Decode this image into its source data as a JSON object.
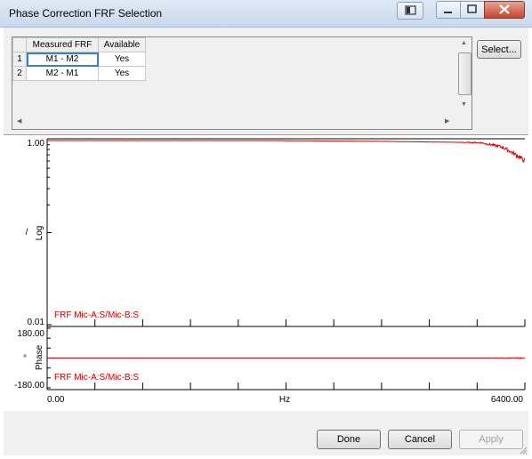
{
  "window": {
    "title": "Phase Correction FRF Selection"
  },
  "table": {
    "columns": [
      "Measured FRF",
      "Available"
    ],
    "rows": [
      {
        "index": "1",
        "frf": "M1 - M2",
        "available": "Yes"
      },
      {
        "index": "2",
        "frf": "M2 - M1",
        "available": "Yes"
      }
    ]
  },
  "buttons": {
    "select": "Select...",
    "done": "Done",
    "cancel": "Cancel",
    "apply": "Apply"
  },
  "graph": {
    "top": {
      "y_max_label": "1.00",
      "y_min_label": "0.01",
      "axis_unit": "/",
      "axis_label": "Log",
      "trace_label": "FRF Mic-A:S/Mic-B:S"
    },
    "bottom": {
      "y_max_label": "180.00",
      "y_min_label": "-180.00",
      "axis_unit": "°",
      "axis_label": "Phase",
      "trace_label": "FRF Mic-A:S/Mic-B:S"
    },
    "x_min_label": "0.00",
    "x_unit_label": "Hz",
    "x_max_label": "6400.00",
    "trace_color": "#cc0000"
  },
  "chart_data": [
    {
      "type": "line",
      "ylabel": "Log",
      "xlim": [
        0,
        6400
      ],
      "ylim": [
        0.01,
        1.0
      ],
      "log_y": true,
      "series": [
        {
          "name": "FRF Mic-A:S/Mic-B:S",
          "x": [
            0,
            3000,
            4500,
            5800,
            6100,
            6400
          ],
          "y": [
            1.0,
            1.0,
            0.98,
            0.95,
            0.85,
            0.6
          ]
        }
      ]
    },
    {
      "type": "line",
      "ylabel": "Phase",
      "xlim": [
        0,
        6400
      ],
      "ylim": [
        -180,
        180
      ],
      "series": [
        {
          "name": "FRF Mic-A:S/Mic-B:S",
          "x": [
            0,
            6400
          ],
          "y": [
            0,
            0
          ]
        }
      ]
    }
  ]
}
